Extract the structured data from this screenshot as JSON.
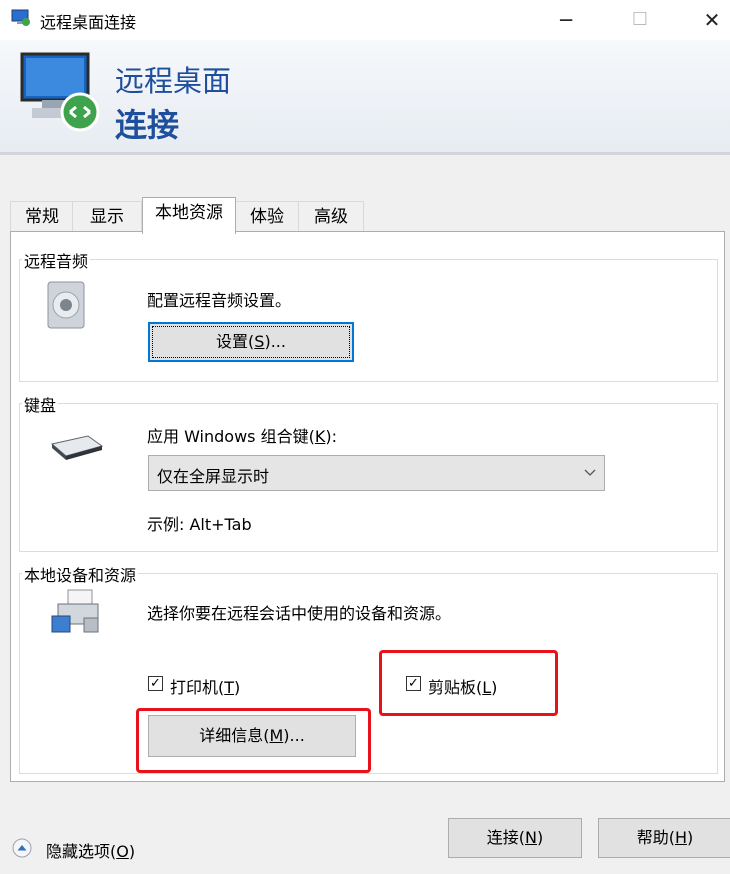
{
  "window": {
    "title": "远程桌面连接",
    "minimize": "─",
    "maximize": "☐",
    "close": "✕"
  },
  "banner": {
    "line1": "远程桌面",
    "line2": "连接"
  },
  "tabs": [
    {
      "label": "常规"
    },
    {
      "label": "显示"
    },
    {
      "label": "本地资源",
      "active": true
    },
    {
      "label": "体验"
    },
    {
      "label": "高级"
    }
  ],
  "audio": {
    "legend": "远程音频",
    "description": "配置远程音频设置。",
    "button_label": "设置(",
    "button_key": "S",
    "button_suffix": ")..."
  },
  "keyboard": {
    "legend": "键盘",
    "label_prefix": "应用 Windows 组合键(",
    "label_key": "K",
    "label_suffix": "):",
    "selected": "仅在全屏显示时",
    "example": "示例: Alt+Tab"
  },
  "devices": {
    "legend": "本地设备和资源",
    "description": "选择你要在远程会话中使用的设备和资源。",
    "printer_label": "打印机(",
    "printer_key": "T",
    "printer_suffix": ")",
    "printer_checked": true,
    "clipboard_label": "剪贴板(",
    "clipboard_key": "L",
    "clipboard_suffix": ")",
    "clipboard_checked": true,
    "details_label": "详细信息(",
    "details_key": "M",
    "details_suffix": ")..."
  },
  "footer": {
    "hide_options_label": "隐藏选项(",
    "hide_options_key": "O",
    "hide_options_suffix": ")",
    "connect_label": "连接(",
    "connect_key": "N",
    "connect_suffix": ")",
    "help_label": "帮助(",
    "help_key": "H",
    "help_suffix": ")"
  },
  "colors": {
    "accent": "#0078d7",
    "banner_text": "#1e4f9c",
    "highlight": "#e8131a"
  }
}
